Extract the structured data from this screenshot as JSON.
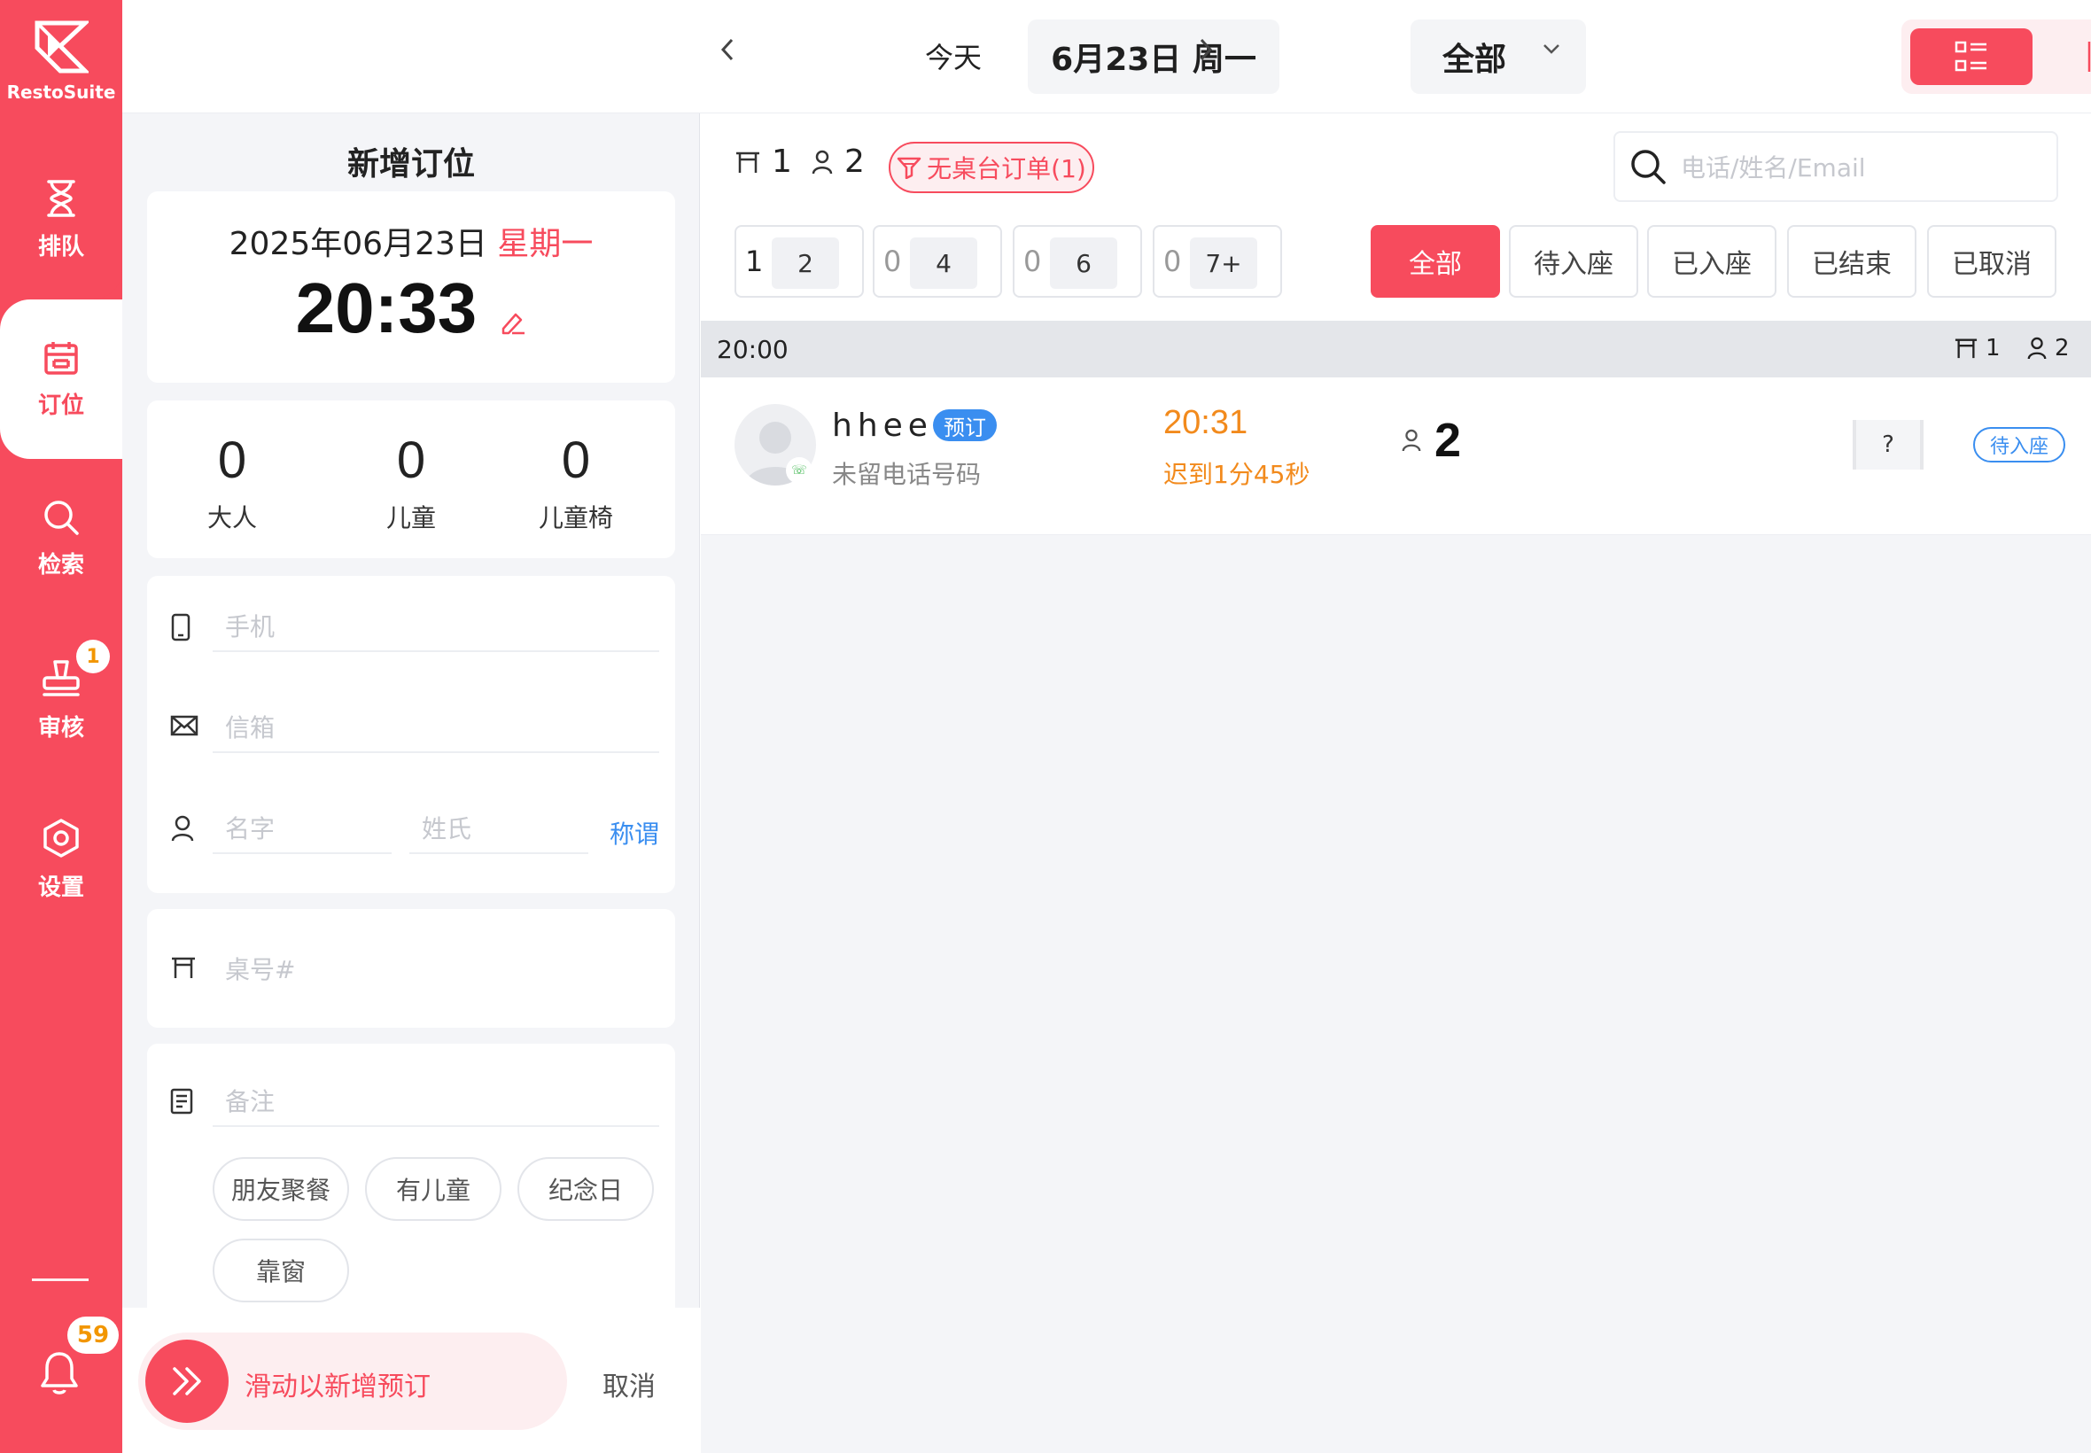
{
  "app": {
    "name": "RestoSuite",
    "accent": "#f74b5d"
  },
  "sidebar": {
    "items": [
      {
        "label": "排队",
        "icon": "hourglass-icon"
      },
      {
        "label": "订位",
        "icon": "calendar-icon",
        "active": true
      },
      {
        "label": "检索",
        "icon": "search-icon"
      },
      {
        "label": "审核",
        "icon": "stamp-icon",
        "badge": "1"
      },
      {
        "label": "设置",
        "icon": "settings-icon"
      }
    ],
    "notifications_badge": "59"
  },
  "topbar": {
    "today_label": "今天",
    "date_label": "6月23日 周一",
    "scope_label": "全部"
  },
  "form": {
    "title": "新增订位",
    "date": "2025年06月23日",
    "weekday": "星期一",
    "time": "20:33",
    "counts": [
      {
        "value": "0",
        "label": "大人"
      },
      {
        "value": "0",
        "label": "儿童"
      },
      {
        "value": "0",
        "label": "儿童椅"
      }
    ],
    "phone_placeholder": "手机",
    "email_placeholder": "信箱",
    "first_name_placeholder": "名字",
    "last_name_placeholder": "姓氏",
    "salutation_label": "称谓",
    "table_placeholder": "桌号#",
    "note_placeholder": "备注",
    "tags": [
      "朋友聚餐",
      "有儿童",
      "纪念日",
      "靠窗"
    ],
    "slide_label": "滑动以新增预订",
    "cancel_label": "取消"
  },
  "list": {
    "table_count": "1",
    "guest_count": "2",
    "no_table_label": "无桌台订单(1)",
    "search_placeholder": "电话/姓名/Email",
    "party_filters": [
      {
        "count": "1",
        "size": "2"
      },
      {
        "count": "0",
        "size": "4"
      },
      {
        "count": "0",
        "size": "6"
      },
      {
        "count": "0",
        "size": "7+"
      }
    ],
    "status_filters": [
      "全部",
      "待入座",
      "已入座",
      "已结束",
      "已取消"
    ],
    "groups": [
      {
        "time": "20:00",
        "tables": "1",
        "guests": "2",
        "rows": [
          {
            "name": "hhee",
            "badge": "预订",
            "phone": "未留电话号码",
            "time": "20:31",
            "late": "迟到1分45秒",
            "party": "2",
            "table": "?",
            "status": "待入座"
          }
        ]
      }
    ]
  }
}
